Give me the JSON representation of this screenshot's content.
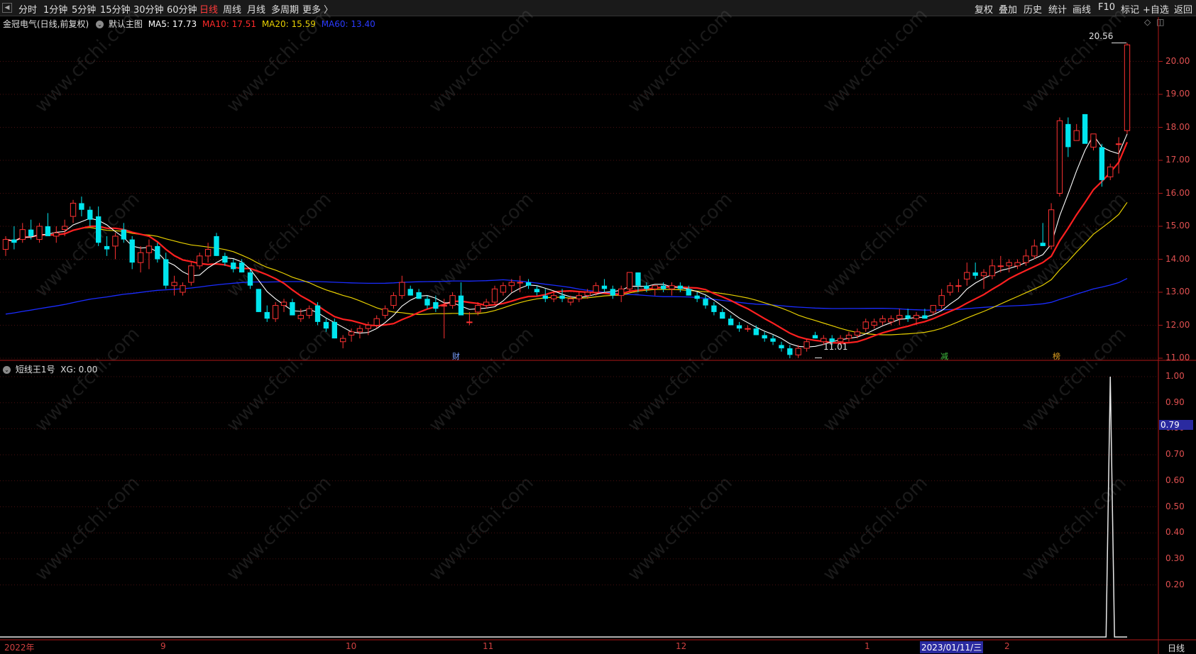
{
  "toolbar": {
    "periods": [
      "分时",
      "1分钟",
      "5分钟",
      "15分钟",
      "30分钟",
      "60分钟",
      "日线",
      "周线",
      "月线",
      "多周期",
      "更多 〉"
    ],
    "active_period": "日线",
    "tools": [
      "复权",
      "叠加",
      "历史",
      "统计",
      "画线",
      "F10",
      "标记",
      "+自选",
      "返回"
    ]
  },
  "main_chart": {
    "title": "金冠电气(日线,前复权)",
    "indicator_name": "默认主图",
    "ma5": "MA5: 17.73",
    "ma10": "MA10: 17.51",
    "ma20": "MA20: 15.59",
    "ma60": "MA60: 13.40",
    "max_label": "20.56",
    "min_label": "11.01",
    "y_ticks": [
      "20.00",
      "19.00",
      "18.00",
      "17.00",
      "16.00",
      "15.00",
      "14.00",
      "13.00",
      "12.00",
      "11.00"
    ],
    "event_marks": [
      "财",
      "减",
      "榜"
    ],
    "colors": {
      "up": "#ff3232",
      "down": "#00e5ee",
      "ma5": "#ffffff",
      "ma10": "#ff2020",
      "ma20": "#e8d000",
      "ma60": "#1a2cff"
    }
  },
  "sub_chart": {
    "title": "短线王1号",
    "value": "XG: 0.00",
    "y_ticks": [
      "1.00",
      "0.90",
      "0.80",
      "0.70",
      "0.60",
      "0.50",
      "0.40",
      "0.30",
      "0.20"
    ],
    "cursor_value": "0.79"
  },
  "x_axis": {
    "labels": [
      "2022年",
      "9",
      "10",
      "11",
      "12",
      "1",
      "2"
    ],
    "cursor_date": "2023/01/11/三",
    "period_label": "日线"
  },
  "watermark": "www.cfchi.com",
  "chart_data": {
    "type": "candlestick",
    "title": "金冠电气(日线,前复权)",
    "ohlc": [
      [
        14.3,
        14.7,
        14.1,
        14.6
      ],
      [
        14.6,
        15.0,
        14.3,
        14.5
      ],
      [
        14.6,
        15.1,
        14.5,
        14.9
      ],
      [
        14.9,
        15.2,
        14.6,
        14.7
      ],
      [
        14.6,
        15.1,
        14.5,
        15.0
      ],
      [
        15.0,
        15.4,
        14.8,
        14.7
      ],
      [
        14.7,
        15.0,
        14.5,
        14.8
      ],
      [
        14.9,
        15.2,
        14.7,
        15.0
      ],
      [
        15.3,
        15.8,
        15.1,
        15.7
      ],
      [
        15.7,
        15.9,
        15.3,
        15.5
      ],
      [
        15.5,
        15.6,
        15.0,
        15.2
      ],
      [
        15.3,
        15.6,
        14.4,
        14.5
      ],
      [
        14.4,
        14.7,
        14.1,
        14.3
      ],
      [
        14.4,
        14.8,
        14.0,
        14.7
      ],
      [
        14.9,
        15.1,
        14.5,
        14.6
      ],
      [
        14.6,
        14.7,
        13.7,
        13.9
      ],
      [
        13.9,
        14.4,
        13.6,
        14.2
      ],
      [
        14.2,
        14.6,
        13.7,
        14.4
      ],
      [
        14.4,
        14.5,
        13.9,
        14.0
      ],
      [
        14.0,
        14.2,
        13.1,
        13.2
      ],
      [
        13.2,
        13.5,
        12.9,
        13.3
      ],
      [
        13.0,
        13.3,
        12.9,
        13.2
      ],
      [
        13.3,
        13.9,
        13.2,
        13.8
      ],
      [
        13.8,
        14.2,
        13.7,
        14.1
      ],
      [
        14.1,
        14.5,
        13.9,
        14.3
      ],
      [
        14.7,
        14.8,
        14.1,
        14.1
      ],
      [
        14.1,
        14.2,
        13.8,
        13.9
      ],
      [
        13.9,
        14.0,
        13.6,
        13.7
      ],
      [
        13.9,
        14.0,
        13.6,
        13.6
      ],
      [
        13.6,
        13.7,
        13.1,
        13.2
      ],
      [
        13.1,
        13.1,
        12.4,
        12.4
      ],
      [
        12.4,
        12.6,
        12.1,
        12.2
      ],
      [
        12.2,
        12.7,
        12.1,
        12.6
      ],
      [
        12.6,
        12.8,
        12.4,
        12.7
      ],
      [
        12.7,
        12.8,
        12.3,
        12.3
      ],
      [
        12.2,
        12.5,
        12.1,
        12.3
      ],
      [
        12.3,
        12.6,
        12.2,
        12.5
      ],
      [
        12.6,
        12.7,
        12.0,
        12.1
      ],
      [
        12.1,
        12.2,
        11.8,
        11.9
      ],
      [
        12.1,
        12.2,
        11.6,
        11.6
      ],
      [
        11.5,
        11.7,
        11.3,
        11.6
      ],
      [
        11.7,
        11.9,
        11.5,
        11.8
      ],
      [
        11.8,
        12.0,
        11.6,
        11.9
      ],
      [
        11.9,
        12.1,
        11.7,
        12.0
      ],
      [
        12.0,
        12.3,
        11.9,
        12.2
      ],
      [
        12.3,
        12.6,
        12.2,
        12.5
      ],
      [
        12.6,
        13.0,
        12.5,
        12.9
      ],
      [
        12.9,
        13.5,
        12.8,
        13.3
      ],
      [
        13.1,
        13.2,
        12.9,
        12.9
      ],
      [
        13.0,
        13.1,
        12.8,
        12.8
      ],
      [
        12.8,
        12.9,
        12.5,
        12.6
      ],
      [
        12.7,
        12.9,
        12.4,
        12.5
      ],
      [
        12.6,
        12.8,
        11.6,
        12.6
      ],
      [
        12.6,
        13.0,
        12.5,
        12.9
      ],
      [
        12.9,
        13.3,
        12.8,
        12.3
      ],
      [
        12.1,
        12.4,
        12.0,
        12.1
      ],
      [
        12.4,
        12.7,
        12.3,
        12.6
      ],
      [
        12.6,
        12.8,
        12.5,
        12.7
      ],
      [
        12.7,
        13.2,
        12.6,
        13.1
      ],
      [
        13.0,
        13.3,
        12.9,
        13.2
      ],
      [
        13.2,
        13.4,
        13.0,
        13.3
      ],
      [
        13.3,
        13.5,
        13.0,
        13.3
      ],
      [
        13.3,
        13.4,
        13.1,
        13.2
      ],
      [
        13.1,
        13.2,
        12.9,
        13.0
      ],
      [
        12.9,
        13.1,
        12.7,
        12.8
      ],
      [
        12.8,
        13.0,
        12.7,
        12.9
      ],
      [
        12.9,
        13.1,
        12.7,
        12.8
      ],
      [
        12.7,
        12.9,
        12.6,
        12.8
      ],
      [
        12.8,
        13.0,
        12.7,
        12.9
      ],
      [
        12.9,
        13.1,
        12.8,
        13.0
      ],
      [
        13.0,
        13.3,
        12.9,
        13.2
      ],
      [
        13.2,
        13.4,
        13.0,
        13.1
      ],
      [
        13.1,
        13.2,
        12.8,
        12.9
      ],
      [
        12.9,
        13.2,
        12.7,
        13.1
      ],
      [
        13.1,
        13.6,
        13.0,
        13.6
      ],
      [
        13.6,
        13.6,
        13.0,
        13.2
      ],
      [
        13.2,
        13.3,
        13.0,
        13.1
      ],
      [
        13.1,
        13.2,
        12.9,
        13.2
      ],
      [
        13.2,
        13.3,
        13.0,
        13.1
      ],
      [
        13.1,
        13.3,
        12.9,
        13.2
      ],
      [
        13.2,
        13.3,
        13.0,
        13.1
      ],
      [
        13.1,
        13.2,
        12.9,
        12.9
      ],
      [
        12.9,
        13.0,
        12.7,
        12.8
      ],
      [
        12.8,
        12.9,
        12.5,
        12.6
      ],
      [
        12.6,
        12.7,
        12.3,
        12.4
      ],
      [
        12.4,
        12.5,
        12.2,
        12.2
      ],
      [
        12.2,
        12.3,
        12.0,
        12.0
      ],
      [
        12.0,
        12.1,
        11.8,
        11.9
      ],
      [
        11.9,
        12.0,
        11.8,
        11.9
      ],
      [
        11.9,
        12.0,
        11.7,
        11.7
      ],
      [
        11.7,
        11.8,
        11.5,
        11.6
      ],
      [
        11.6,
        11.7,
        11.4,
        11.5
      ],
      [
        11.4,
        11.5,
        11.2,
        11.3
      ],
      [
        11.3,
        11.4,
        11.0,
        11.1
      ],
      [
        11.1,
        11.4,
        11.01,
        11.3
      ],
      [
        11.3,
        11.6,
        11.2,
        11.5
      ],
      [
        11.7,
        11.8,
        11.6,
        11.6
      ],
      [
        11.5,
        11.7,
        11.4,
        11.6
      ],
      [
        11.6,
        11.7,
        11.4,
        11.5
      ],
      [
        11.5,
        11.7,
        11.4,
        11.6
      ],
      [
        11.6,
        11.8,
        11.5,
        11.7
      ],
      [
        11.7,
        11.9,
        11.6,
        11.8
      ],
      [
        11.9,
        12.2,
        11.8,
        12.1
      ],
      [
        12.0,
        12.2,
        11.9,
        12.1
      ],
      [
        12.1,
        12.3,
        12.0,
        12.2
      ],
      [
        12.1,
        12.3,
        12.0,
        12.2
      ],
      [
        12.2,
        12.5,
        12.0,
        12.3
      ],
      [
        12.3,
        12.5,
        12.1,
        12.2
      ],
      [
        12.2,
        12.4,
        12.0,
        12.3
      ],
      [
        12.3,
        12.5,
        12.2,
        12.2
      ],
      [
        12.4,
        12.6,
        12.3,
        12.6
      ],
      [
        12.6,
        13.1,
        12.5,
        12.9
      ],
      [
        13.0,
        13.3,
        12.9,
        13.2
      ],
      [
        13.2,
        13.4,
        13.0,
        13.2
      ],
      [
        13.4,
        13.9,
        13.2,
        13.6
      ],
      [
        13.6,
        13.9,
        13.4,
        13.5
      ],
      [
        13.5,
        13.7,
        13.1,
        13.6
      ],
      [
        13.5,
        14.0,
        13.4,
        13.8
      ],
      [
        13.8,
        14.1,
        13.6,
        13.8
      ],
      [
        13.8,
        14.0,
        13.6,
        13.9
      ],
      [
        13.8,
        14.0,
        13.7,
        13.9
      ],
      [
        13.9,
        14.3,
        13.8,
        14.1
      ],
      [
        14.1,
        14.6,
        14.0,
        14.4
      ],
      [
        14.5,
        15.1,
        14.4,
        14.4
      ],
      [
        14.4,
        15.7,
        14.3,
        15.5
      ],
      [
        16.0,
        18.3,
        15.9,
        18.2
      ],
      [
        18.1,
        18.3,
        17.1,
        17.4
      ],
      [
        17.6,
        18.1,
        17.6,
        17.9
      ],
      [
        18.4,
        18.4,
        17.6,
        17.5
      ],
      [
        17.4,
        17.8,
        17.3,
        17.8
      ],
      [
        17.4,
        17.5,
        16.2,
        16.4
      ],
      [
        16.5,
        16.9,
        16.4,
        16.8
      ],
      [
        17.5,
        17.7,
        16.6,
        17.5
      ],
      [
        17.9,
        20.56,
        17.8,
        20.5
      ]
    ]
  }
}
